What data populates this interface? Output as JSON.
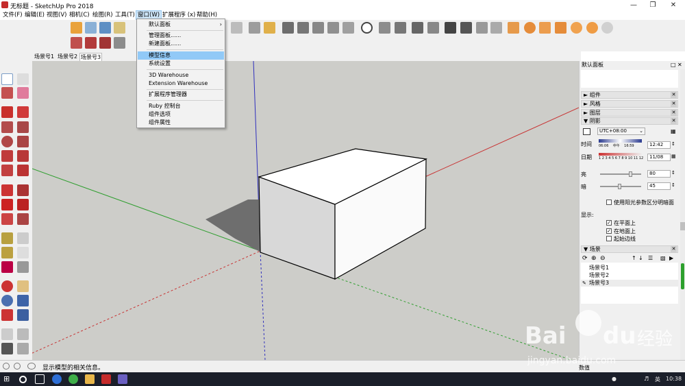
{
  "window": {
    "title": "无标题 - SketchUp Pro 2018"
  },
  "menubar": {
    "items": [
      "文件(F)",
      "编辑(E)",
      "视图(V)",
      "相机(C)",
      "绘图(R)",
      "工具(T)",
      "窗口(W)",
      "扩展程序 (x)",
      "帮助(H)"
    ],
    "active_index": 6
  },
  "window_menu": {
    "items": [
      "默认面板",
      "管理面板......",
      "新建面板......",
      "模型信息",
      "系统设置",
      "3D Warehouse",
      "Extension Warehouse",
      "扩展程序管理器",
      "Ruby 控制台",
      "组件选项",
      "组件属性"
    ],
    "highlighted": "模型信息"
  },
  "scene_tabs": [
    "场景号1",
    "场景号2",
    "场景号3"
  ],
  "scene_tab_selected": 2,
  "panel": {
    "title": "默认面板",
    "sections": {
      "components": "组件",
      "styles": "风格",
      "layers": "图层",
      "shadows": "阴影",
      "scenes": "场景"
    },
    "shadow": {
      "timezone": "UTC+08:00",
      "time_label": "时间",
      "time_ticks": [
        "06:06",
        "中午",
        "16:59"
      ],
      "time_value": "12:42",
      "date_label": "日期",
      "months": "1 2 3 4 5 6 7 8 9 10 11 12",
      "date_value": "11/08",
      "light_label": "亮",
      "light_value": "80",
      "dark_label": "暗",
      "dark_value": "45",
      "sun_for_shading": "使用阳光参数区分明暗面",
      "display_label": "显示:",
      "on_faces": "在平面上",
      "on_ground": "在地面上",
      "from_edges": "起始边线"
    },
    "scenes": [
      "场景号1",
      "场景号2",
      "场景号3"
    ]
  },
  "status": {
    "text": "显示模型的相关信息。",
    "measure_label": "数值"
  },
  "taskbar": {
    "time": "10:38",
    "ime": "英"
  },
  "watermark": {
    "brand": "Bai",
    "brand2": "du",
    "suffix": "经验",
    "url": "jingyan.baidu.com"
  }
}
